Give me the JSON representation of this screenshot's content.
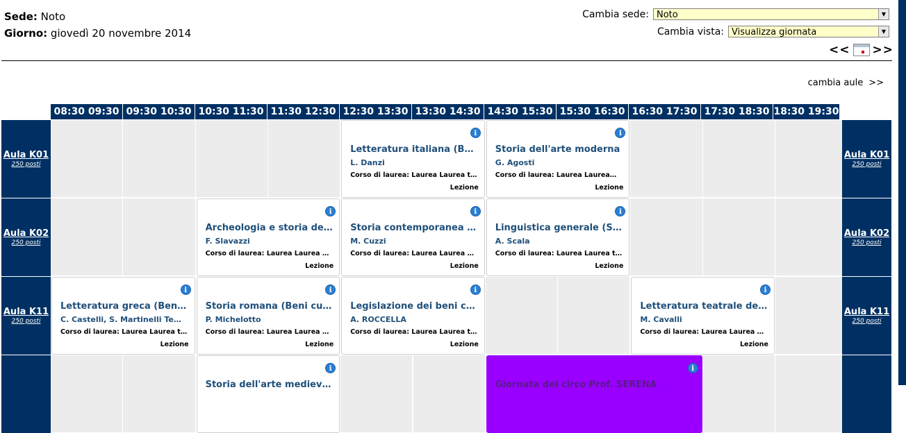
{
  "header": {
    "sede_label": "Sede:",
    "sede_value": "Noto",
    "giorno_label": "Giorno:",
    "giorno_value": "giovedì 20 novembre 2014"
  },
  "controls": {
    "cambia_sede_label": "Cambia sede:",
    "cambia_sede_value": "Noto",
    "cambia_vista_label": "Cambia vista:",
    "cambia_vista_value": "Visualizza giornata",
    "prev_label": "<<",
    "next_label": ">>"
  },
  "cambia_aule": {
    "label": "cambia aule",
    "arrow": ">>"
  },
  "time_slots": [
    "08:30 09:30",
    "09:30 10:30",
    "10:30 11:30",
    "11:30 12:30",
    "12:30 13:30",
    "13:30 14:30",
    "14:30 15:30",
    "15:30 16:30",
    "16:30 17:30",
    "17:30 18:30",
    "18:30 19:30"
  ],
  "rooms": [
    {
      "name": "Aula K01",
      "seats": "250 posti",
      "events": [
        {
          "title": "Letteratura italiana (Beni c…",
          "teacher": "L. Danzi",
          "course": "Corso di laurea: Laurea Laurea t…",
          "type": "Lezione"
        },
        {
          "title": "Storia dell'arte moderna",
          "teacher": "G. Agosti",
          "course": "Corso di laurea: Laurea Laurea…",
          "type": "Lezione"
        }
      ]
    },
    {
      "name": "Aula K02",
      "seats": "250 posti",
      "events": [
        {
          "title": "Archeologia e storia dell'ar…",
          "teacher": "F. Slavazzi",
          "course": "Corso di laurea: Laurea Laurea …",
          "type": "Lezione"
        },
        {
          "title": "Storia contemporanea (Sc.…",
          "teacher": "M. Cuzzi",
          "course": "Corso di laurea: Laurea Laurea …",
          "type": "Lezione"
        },
        {
          "title": "Linguistica generale (Sc. C…",
          "teacher": "A. Scala",
          "course": "Corso di laurea: Laurea Laurea t…",
          "type": "Lezione"
        }
      ]
    },
    {
      "name": "Aula K11",
      "seats": "250 posti",
      "events": [
        {
          "title": "Letteratura greca (Beni cul…",
          "teacher": "C. Castelli, S. Martinelli Te…",
          "course": "Corso di laurea: Laurea Laurea t…",
          "type": "Lezione"
        },
        {
          "title": "Storia romana (Beni cultur…",
          "teacher": "P. Michelotto",
          "course": "Corso di laurea: Laurea Laurea …",
          "type": "Lezione"
        },
        {
          "title": "Legislazione dei beni cultur…",
          "teacher": "A. ROCCELLA",
          "course": "Corso di laurea: Laurea Laurea t…",
          "type": "Lezione"
        },
        {
          "title": "Letteratura teatrale della …",
          "teacher": "M. Cavalli",
          "course": "Corso di laurea: Laurea Laurea …",
          "type": "Lezione"
        }
      ]
    },
    {
      "name": "",
      "seats": "",
      "events": [
        {
          "title": "Storia dell'arte medievale",
          "teacher": "",
          "course": "",
          "type": ""
        },
        {
          "title": "Giornata del circo Prof. SERENA",
          "teacher": "",
          "course": "",
          "type": ""
        }
      ]
    }
  ],
  "colors": {
    "accent": "#003063",
    "empty_cell": "#ececec",
    "special_event": "#9900ff",
    "title_text": "#1f4f7a"
  },
  "icons": {
    "info": "info-icon",
    "calendar": "calendar-icon"
  }
}
